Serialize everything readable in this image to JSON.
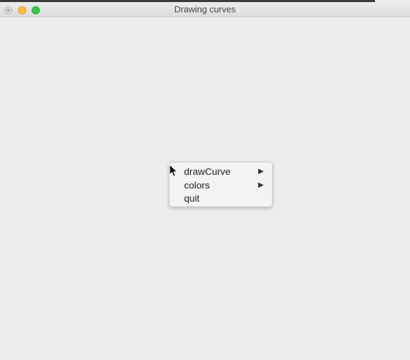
{
  "window": {
    "title": "Drawing curves"
  },
  "context_menu": {
    "items": [
      {
        "label": "drawCurve",
        "has_submenu": true
      },
      {
        "label": "colors",
        "has_submenu": true
      },
      {
        "label": "quit",
        "has_submenu": false
      }
    ]
  },
  "icons": {
    "close": "close-icon",
    "minimize": "minimize-icon",
    "maximize": "maximize-icon",
    "submenu": "chevron-right-icon",
    "cursor": "arrow-cursor-icon"
  },
  "colors": {
    "background": "#ececec",
    "close": "#d6d6d6",
    "minimize": "#fdbc40",
    "maximize": "#34c84a"
  }
}
